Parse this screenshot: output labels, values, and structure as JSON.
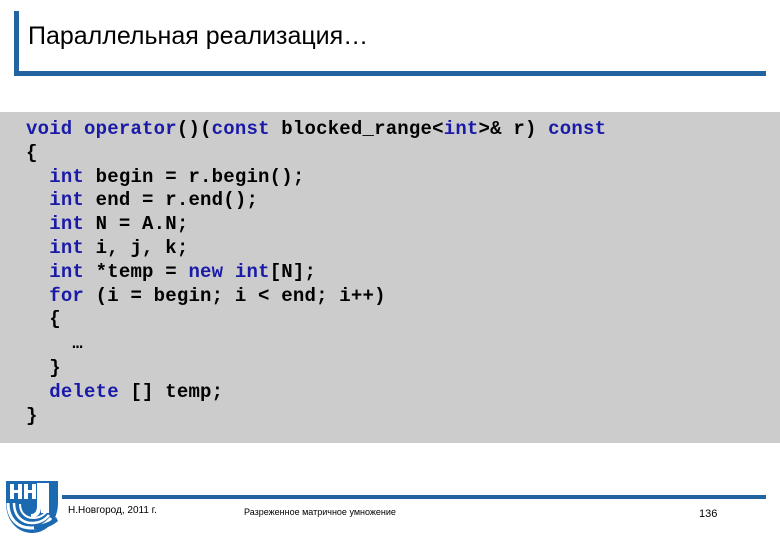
{
  "slide": {
    "title": "Параллельная реализация…",
    "accent_color": "#2364A0",
    "code_background_color": "#CCCCCC",
    "keyword_color": "#1A1AA8"
  },
  "code": {
    "language": "cpp",
    "lines": [
      "void operator()(const blocked_range<int>& r) const",
      "{",
      "  int begin = r.begin();",
      "  int end = r.end();",
      "  int N = A.N;",
      "  int i, j, k;",
      "  int *temp = new int[N];",
      "  for (i = begin; i < end; i++)",
      "  {",
      "    …",
      "  }",
      "  delete [] temp;",
      "}"
    ],
    "keywords": [
      "void",
      "operator",
      "const",
      "int",
      "new",
      "for",
      "delete"
    ]
  },
  "footer": {
    "place_date": "Н.Новгород, 2011 г.",
    "topic": "Разреженное матричное умножение",
    "page_number": "136",
    "logo_name": "unn-logo",
    "logo_color": "#1B69B0"
  }
}
